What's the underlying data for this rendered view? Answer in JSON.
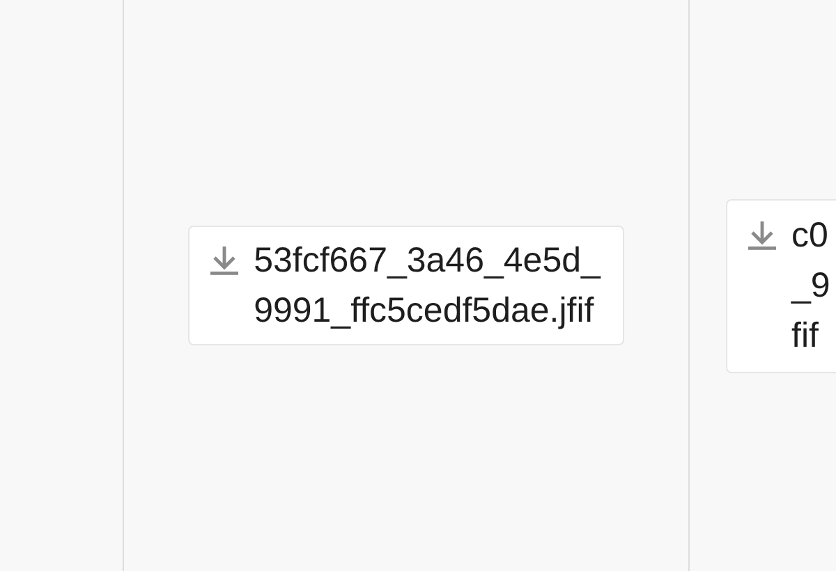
{
  "file_cards": [
    {
      "lines": [
        "53fcf667_3a46_4e5d_",
        "9991_ffc5cedf5dae.jfif"
      ]
    },
    {
      "lines": [
        "c0",
        "_9",
        "fif"
      ]
    }
  ]
}
